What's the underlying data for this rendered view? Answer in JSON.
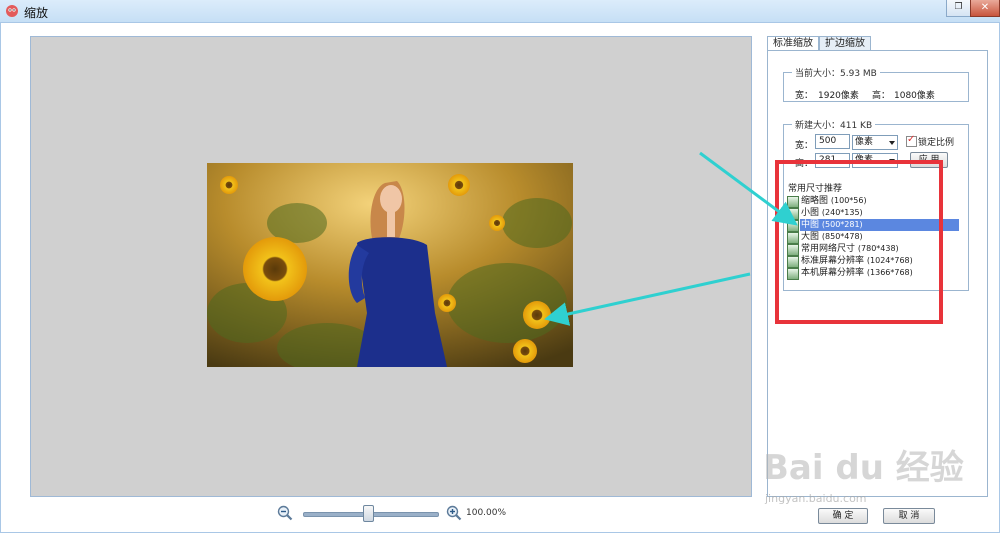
{
  "window": {
    "title": "缩放",
    "restore_glyph": "❐",
    "close_glyph": "✕"
  },
  "zoom": {
    "value": "100.00%",
    "slider_level": 0.5
  },
  "tabs": [
    "标准缩放",
    "扩边缩放"
  ],
  "current_size": {
    "legend": "当前大小：5.93 MB",
    "width_label": "宽：",
    "width_value": "1920像素",
    "height_label": "高：",
    "height_value": "1080像素"
  },
  "new_size": {
    "legend": "新建大小：411 KB",
    "width_label": "宽：",
    "width_value": "500",
    "width_unit": "像素",
    "height_label": "高：",
    "height_value": "281",
    "height_unit": "像素",
    "lock_label": "锁定比例",
    "lock_checked": true,
    "apply_label": "应 用"
  },
  "presets": {
    "title": "常用尺寸推荐",
    "items": [
      {
        "name": "缩略图",
        "dim": "(100*56)"
      },
      {
        "name": "小图",
        "dim": "(240*135)"
      },
      {
        "name": "中图",
        "dim": "(500*281)",
        "selected": true
      },
      {
        "name": "大图",
        "dim": "(850*478)"
      },
      {
        "name": "常用网络尺寸",
        "dim": "(780*438)"
      },
      {
        "name": "标准屏幕分辨率",
        "dim": "(1024*768)"
      },
      {
        "name": "本机屏幕分辨率",
        "dim": "(1366*768)"
      }
    ]
  },
  "buttons": {
    "ok": "确 定",
    "cancel": "取 消"
  },
  "watermark": {
    "brand": "Bai du 经验",
    "url": "jingyan.baidu.com"
  },
  "colors": {
    "highlight_box": "#e8333a",
    "annotation_arrow": "#2fd0d0",
    "selection": "#5b87e0"
  }
}
